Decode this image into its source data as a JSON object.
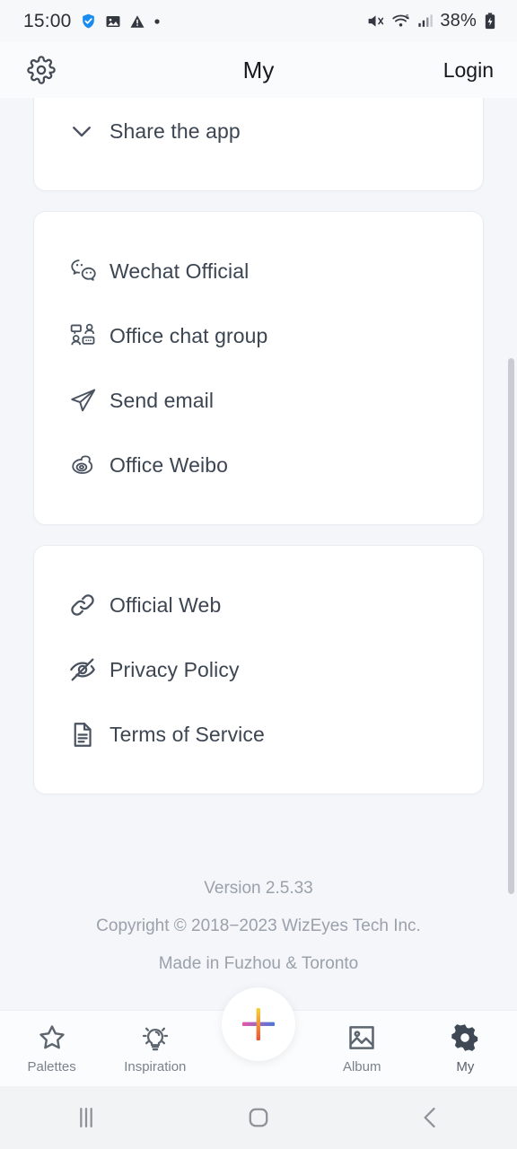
{
  "status_bar": {
    "time": "15:00",
    "battery": "38%",
    "left_icons": [
      "shield-check-icon",
      "image-icon",
      "warning-icon",
      "dot-icon"
    ],
    "right_icons": [
      "mute-icon",
      "wifi-6-icon",
      "signal-bars-icon",
      "battery-charging-icon"
    ]
  },
  "header": {
    "gear_icon": "gear-icon",
    "title": "My",
    "login_label": "Login"
  },
  "cards": [
    {
      "clipped": true,
      "items": [
        {
          "icon": "chevron-down-icon",
          "label": "Share the app"
        }
      ]
    },
    {
      "clipped": false,
      "items": [
        {
          "icon": "wechat-icon",
          "label": "Wechat Official"
        },
        {
          "icon": "office-chat-group-icon",
          "label": "Office chat group"
        },
        {
          "icon": "send-email-icon",
          "label": "Send email"
        },
        {
          "icon": "weibo-icon",
          "label": "Office Weibo"
        }
      ]
    },
    {
      "clipped": false,
      "items": [
        {
          "icon": "link-icon",
          "label": "Official Web"
        },
        {
          "icon": "eye-off-icon",
          "label": "Privacy Policy"
        },
        {
          "icon": "document-icon",
          "label": "Terms of Service"
        }
      ]
    }
  ],
  "footer": {
    "version": "Version 2.5.33",
    "copyright": "Copyright © 2018−2023 WizEyes Tech Inc.",
    "made_in": "Made in Fuzhou & Toronto"
  },
  "fab": {
    "icon": "plus-icon",
    "colors": {
      "horizontal_start": "#e857a8",
      "horizontal_end": "#4a78d8",
      "vertical_start": "#f5d33a",
      "vertical_end": "#e8553a"
    }
  },
  "bottom_nav": {
    "tabs": [
      {
        "icon": "star-icon",
        "label": "Palettes",
        "active": false
      },
      {
        "icon": "lightbulb-icon",
        "label": "Inspiration",
        "active": false
      },
      {
        "icon": "image-icon",
        "label": "Album",
        "active": false
      },
      {
        "icon": "gear-icon",
        "label": "My",
        "active": true
      }
    ]
  },
  "android_nav": {
    "recents_icon": "recents-icon",
    "home_icon": "home-icon",
    "back_icon": "back-icon"
  },
  "colors": {
    "page_background": "#f4f6fa",
    "card_background": "#ffffff",
    "text_primary": "#3c4552",
    "text_muted": "#9aa1ab",
    "scrollbar": "#c9ccd2"
  }
}
